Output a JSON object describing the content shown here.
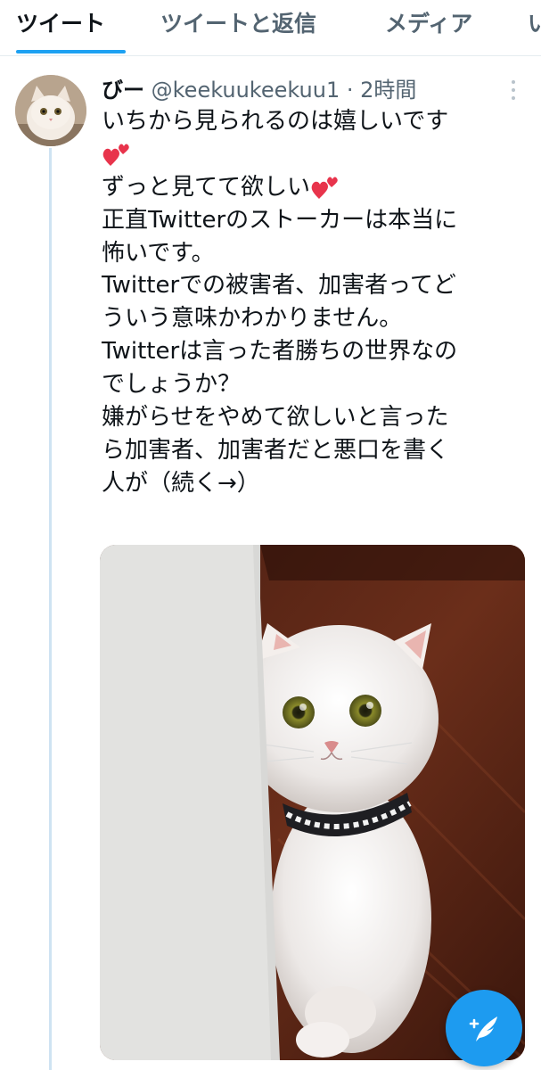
{
  "tabs": [
    {
      "label": "ツイート"
    },
    {
      "label": "ツイートと返信"
    },
    {
      "label": "メディア"
    },
    {
      "label": "い"
    }
  ],
  "tweet": {
    "display_name": "びー",
    "handle": "@keekuukeekuu1",
    "separator": "·",
    "time": "2時間",
    "lines": [
      "いちから見られるのは嬉しいです",
      "",
      "ずっと見てて欲しい",
      "正直Twitterのストーカーは本当に",
      "怖いです。",
      "Twitterでの被害者、加害者ってど",
      "ういう意味かわかりません。",
      "Twitterは言った者勝ちの世界なの",
      "でしょうか？",
      "嫌がらせをやめて欲しいと言った",
      "ら加害者、加害者だと悪口を書く",
      "人が（続く→）"
    ],
    "emoji": "two-hearts-icon"
  },
  "colors": {
    "accent": "#1d9bf0",
    "text": "#0f1419",
    "secondary": "#536471",
    "thread_line": "#cfe3f2",
    "heart": "#e8344c"
  }
}
